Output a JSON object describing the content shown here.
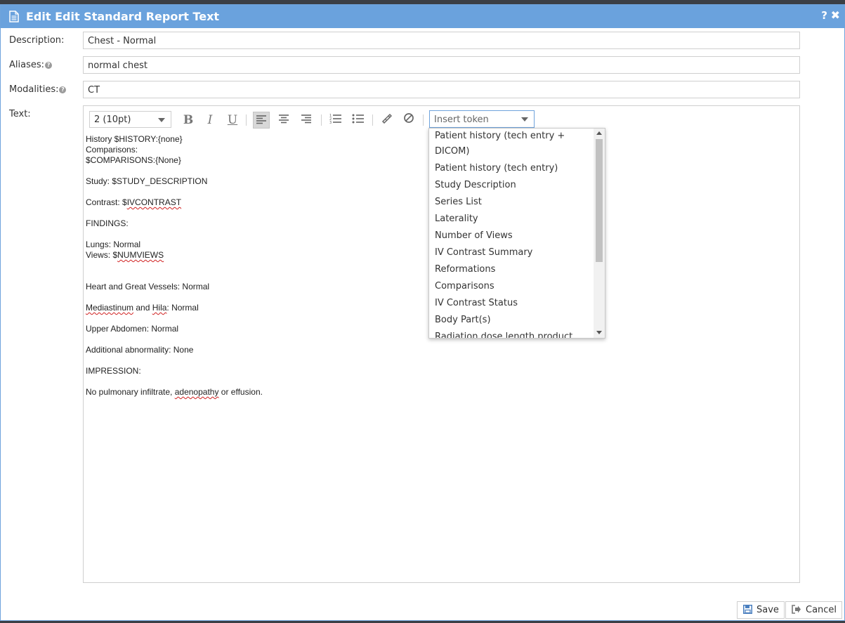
{
  "dialog": {
    "title": "Edit Edit Standard Report Text",
    "help_icon": "?",
    "close_icon": "✖"
  },
  "form": {
    "description": {
      "label": "Description:",
      "value": "Chest - Normal"
    },
    "aliases": {
      "label": "Aliases:",
      "value": "normal chest",
      "help_icon": "?"
    },
    "modalities": {
      "label": "Modalities:",
      "value": "CT",
      "help_icon": "?"
    },
    "text": {
      "label": "Text:"
    }
  },
  "toolbar": {
    "font_size": "2 (10pt)",
    "bold": "B",
    "italic": "I",
    "underline": "U",
    "insert_token_placeholder": "Insert token"
  },
  "editor": {
    "lines": {
      "history": "History $HISTORY:{none}",
      "comparisons_label": "Comparisons:",
      "comparisons_token": "$COMPARISONS:{None}",
      "study": "Study: $STUDY_DESCRIPTION",
      "contrast_prefix": "Contrast: $",
      "contrast_token": "IVCONTRAST",
      "findings": "FINDINGS:",
      "lungs": "Lungs: Normal",
      "views_prefix": "Views: $",
      "views_token": "NUMVIEWS",
      "heart": "Heart and Great Vessels: Normal",
      "mediastinum_word": "Mediastinum",
      "mediastinum_and": " and ",
      "hila_word": "Hila",
      "mediastinum_suffix": ": Normal",
      "upper_abdomen": "Upper Abdomen: Normal",
      "additional": "Additional abnormality: None",
      "impression": "IMPRESSION:",
      "conclusion_prefix": "No pulmonary infiltrate, ",
      "conclusion_word": "adenopathy",
      "conclusion_suffix": " or effusion."
    }
  },
  "token_dropdown": {
    "items": [
      "Patient history (tech entry + DICOM)",
      "Patient history (tech entry)",
      "Study Description",
      "Series List",
      "Laterality",
      "Number of Views",
      "IV Contrast Summary",
      "Reformations",
      "Comparisons",
      "IV Contrast Status",
      "Body Part(s)",
      "Radiation dose length product"
    ]
  },
  "buttons": {
    "save": "Save",
    "cancel": "Cancel"
  },
  "colors": {
    "titlebar": "#6aa2dd",
    "accent_border": "#6fa3dc"
  }
}
